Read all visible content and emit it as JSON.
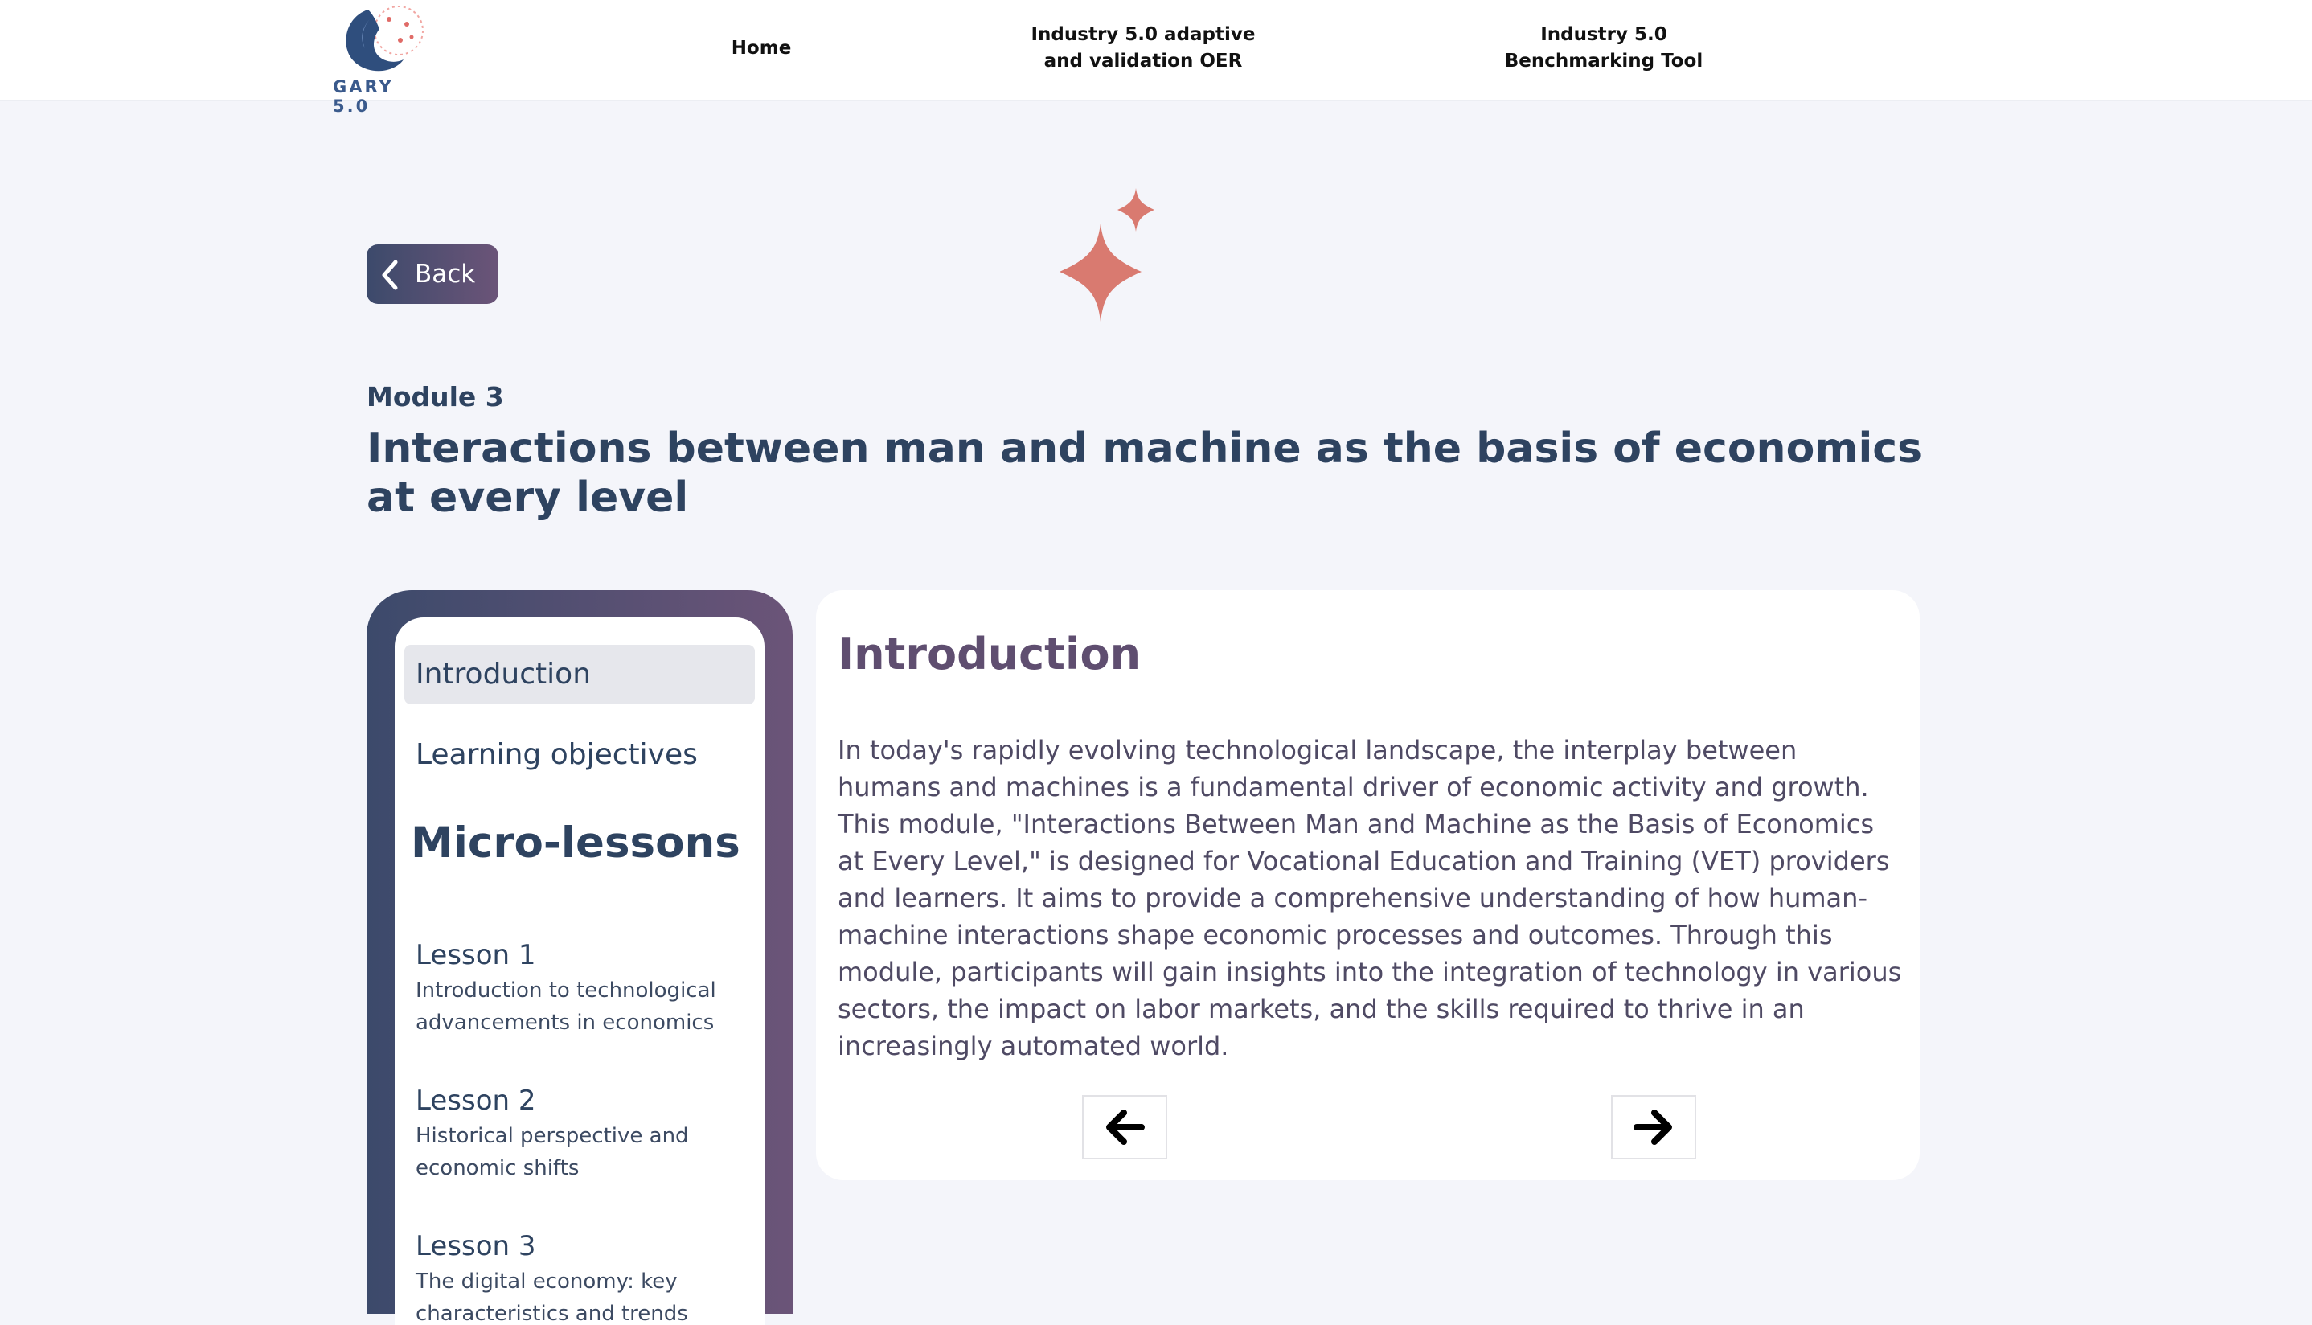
{
  "brand": {
    "logo_text": "GARY 5.0"
  },
  "nav": {
    "home": "Home",
    "oer": "Industry 5.0 adaptive\nand validation OER",
    "bench": "Industry 5.0\nBenchmarking Tool"
  },
  "back_label": "Back",
  "module_label": "Module 3",
  "page_title": "Interactions between man and machine as the basis of economics at every level",
  "sidebar": {
    "intro": "Introduction",
    "objectives": "Learning objectives",
    "micro_heading": "Micro-lessons",
    "lessons": [
      {
        "title": "Lesson 1",
        "desc": "Introduction to technological advancements in economics"
      },
      {
        "title": "Lesson 2",
        "desc": "Historical perspective and economic shifts"
      },
      {
        "title": "Lesson 3",
        "desc": "The digital economy: key characteristics and trends"
      }
    ]
  },
  "content": {
    "title": "Introduction",
    "body": "In today's rapidly evolving technological landscape, the interplay between humans and machines is a fundamental driver of economic activity and growth. This module, \"Interactions Between Man and Machine as the Basis of Economics at Every Level,\" is designed for Vocational Education and Training (VET) providers and learners. It aims to provide a comprehensive understanding of how human-machine interactions shape economic processes and outcomes. Through this module, participants will gain insights into the integration of technology in various sectors, the impact on labor markets, and the skills required to thrive in an increasingly automated world."
  },
  "icons": {
    "prev": "arrow-left-icon",
    "next": "arrow-right-icon",
    "back": "chevron-left-icon",
    "decor": "sparkle-icon"
  },
  "colors": {
    "gradient_start": "#3c4a6b",
    "gradient_end": "#6b5478",
    "sparkle": "#d97a70",
    "heading": "#2e4360",
    "card_title": "#5f4e70"
  }
}
